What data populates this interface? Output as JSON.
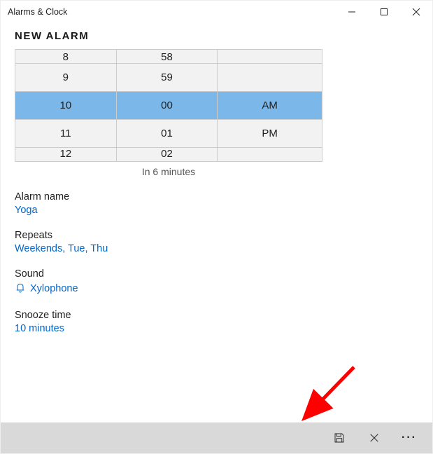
{
  "title": "Alarms & Clock",
  "pageTitle": "NEW ALARM",
  "picker": {
    "rows": [
      {
        "h": "8",
        "m": "58",
        "ampm": "",
        "half": "top"
      },
      {
        "h": "9",
        "m": "59",
        "ampm": "",
        "half": ""
      },
      {
        "h": "10",
        "m": "00",
        "ampm": "AM",
        "sel": true
      },
      {
        "h": "11",
        "m": "01",
        "ampm": "PM",
        "half": ""
      },
      {
        "h": "12",
        "m": "02",
        "ampm": "",
        "half": "bot"
      }
    ],
    "subtitle": "In 6 minutes"
  },
  "fields": {
    "alarmName": {
      "label": "Alarm name",
      "value": "Yoga"
    },
    "repeats": {
      "label": "Repeats",
      "value": "Weekends, Tue, Thu"
    },
    "sound": {
      "label": "Sound",
      "value": "Xylophone"
    },
    "snooze": {
      "label": "Snooze time",
      "value": "10 minutes"
    }
  }
}
